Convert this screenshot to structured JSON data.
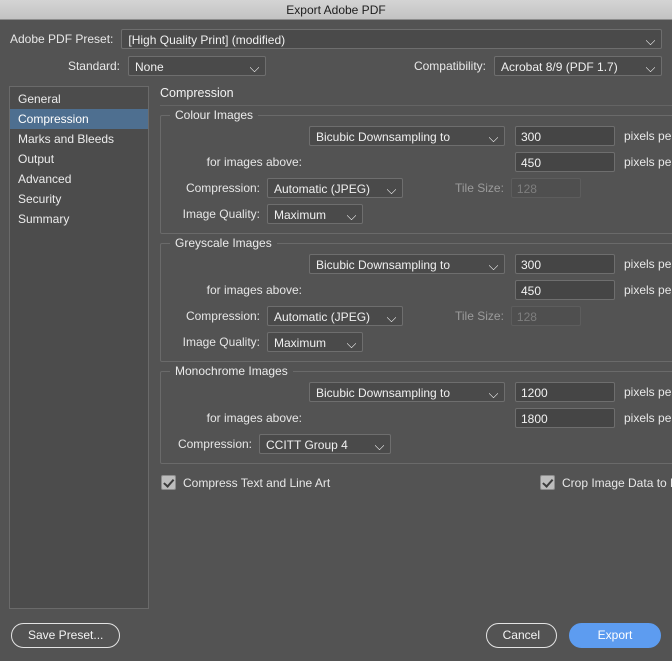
{
  "window": {
    "title": "Export Adobe PDF"
  },
  "top": {
    "preset_label": "Adobe PDF Preset:",
    "preset_value": "[High Quality Print] (modified)",
    "standard_label": "Standard:",
    "standard_value": "None",
    "compatibility_label": "Compatibility:",
    "compatibility_value": "Acrobat 8/9 (PDF 1.7)"
  },
  "sidebar": {
    "items": [
      {
        "label": "General",
        "selected": false
      },
      {
        "label": "Compression",
        "selected": true
      },
      {
        "label": "Marks and Bleeds",
        "selected": false
      },
      {
        "label": "Output",
        "selected": false
      },
      {
        "label": "Advanced",
        "selected": false
      },
      {
        "label": "Security",
        "selected": false
      },
      {
        "label": "Summary",
        "selected": false
      }
    ]
  },
  "panel": {
    "title": "Compression",
    "units_label": "pixels per inch",
    "for_images_above_label": "for images above:",
    "compression_label": "Compression:",
    "image_quality_label": "Image Quality:",
    "tile_size_label": "Tile Size:",
    "colour": {
      "legend": "Colour Images",
      "sampling": "Bicubic Downsampling to",
      "resolution": "300",
      "threshold": "450",
      "compression": "Automatic (JPEG)",
      "tile_size": "128",
      "image_quality": "Maximum"
    },
    "greyscale": {
      "legend": "Greyscale Images",
      "sampling": "Bicubic Downsampling to",
      "resolution": "300",
      "threshold": "450",
      "compression": "Automatic (JPEG)",
      "tile_size": "128",
      "image_quality": "Maximum"
    },
    "monochrome": {
      "legend": "Monochrome Images",
      "sampling": "Bicubic Downsampling to",
      "resolution": "1200",
      "threshold": "1800",
      "compression": "CCITT Group 4"
    },
    "checkboxes": {
      "compress_text": {
        "label": "Compress Text and Line Art",
        "checked": true
      },
      "crop_image": {
        "label": "Crop Image Data to Frames",
        "checked": true
      }
    }
  },
  "footer": {
    "save_preset": "Save Preset...",
    "cancel": "Cancel",
    "export": "Export"
  },
  "colors": {
    "window_bg": "#535353",
    "titlebar_bg": "#c9c9c9",
    "selection_blue": "#4e6f90",
    "primary_button": "#5d9cf0",
    "field_bg": "#454545",
    "border": "#6a6a6a"
  }
}
